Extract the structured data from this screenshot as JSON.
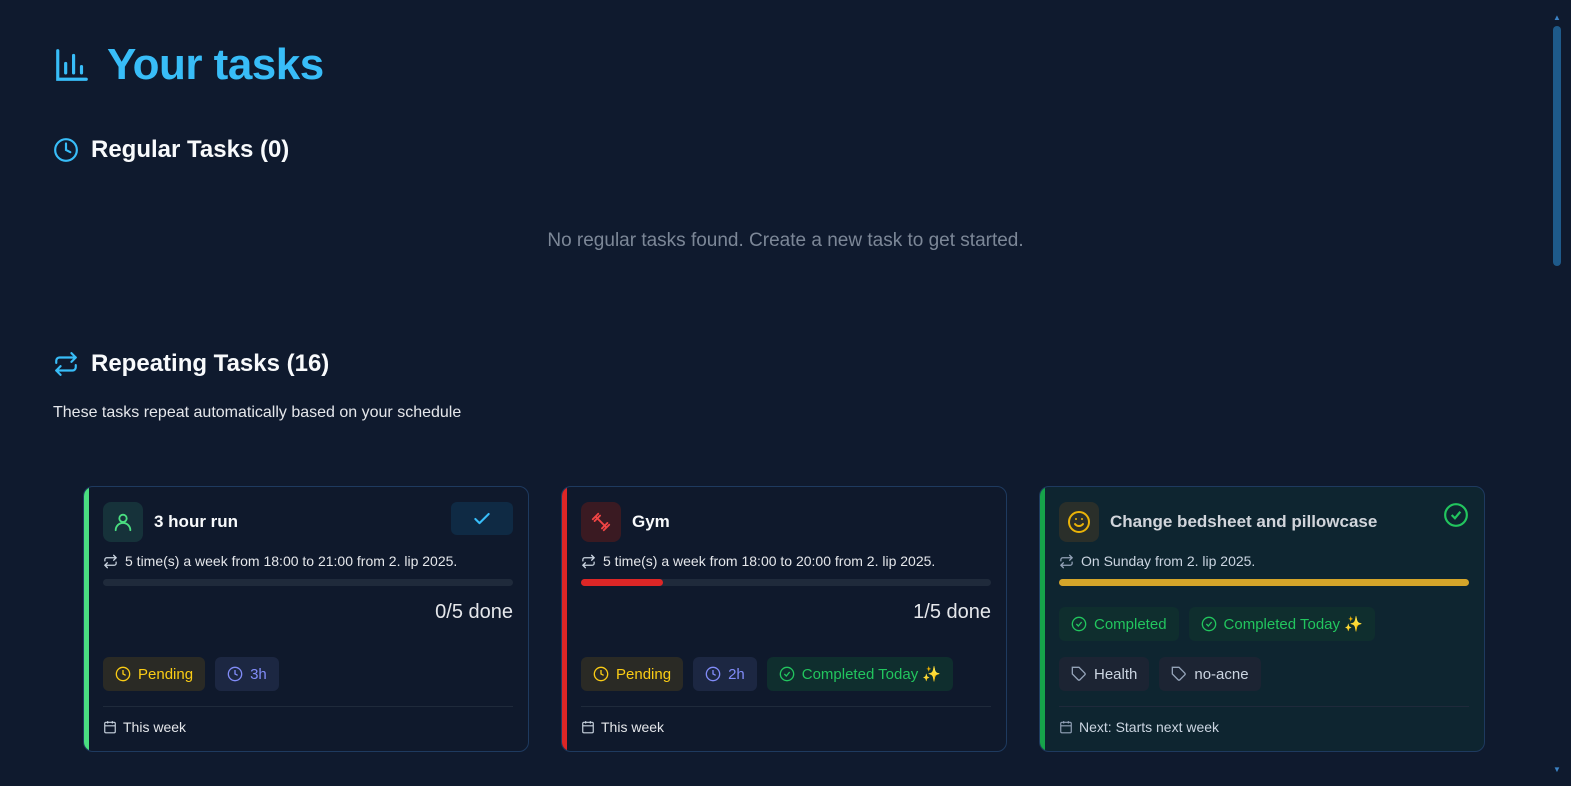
{
  "header": {
    "title": "Your tasks",
    "icon": "bar-chart-icon"
  },
  "regular": {
    "title": "Regular Tasks (0)",
    "empty_message": "No regular tasks found. Create a new task to get started."
  },
  "repeating": {
    "title": "Repeating Tasks (16)",
    "subtitle": "These tasks repeat automatically based on your schedule"
  },
  "cards": [
    {
      "title": "3 hour run",
      "icon": "person-icon",
      "accent": "#4ade80",
      "schedule": "5 time(s) a week from 18:00 to 21:00 from 2. lip 2025.",
      "progress": 0,
      "done": "0/5 done",
      "badges": [
        "Pending",
        "3h"
      ],
      "footer": "This week"
    },
    {
      "title": "Gym",
      "icon": "dumbbell-icon",
      "accent": "#dc2626",
      "schedule": "5 time(s) a week from 18:00 to 20:00 from 2. lip 2025.",
      "progress": 0.2,
      "done": "1/5 done",
      "badges": [
        "Pending",
        "2h",
        "Completed Today ✨"
      ],
      "footer": "This week"
    },
    {
      "title": "Change bedsheet and pillowcase",
      "icon": "smiley-icon",
      "accent": "#16a34a",
      "schedule": "On Sunday from 2. lip 2025.",
      "progress": 1,
      "progress_color": "#eab308",
      "badges": [
        "Completed",
        "Completed Today ✨"
      ],
      "tags": [
        "Health",
        "no-acne"
      ],
      "footer": "Next: Starts next week"
    }
  ]
}
